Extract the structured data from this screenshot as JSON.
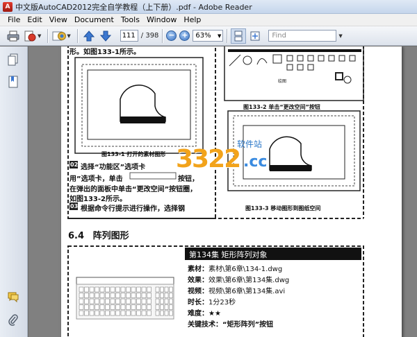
{
  "window": {
    "title": "中文版AutoCAD2012完全自学教程（上下册）.pdf - Adobe Reader"
  },
  "menu": [
    "File",
    "Edit",
    "View",
    "Document",
    "Tools",
    "Window",
    "Help"
  ],
  "toolbar": {
    "page_current": "111",
    "page_total": "/ 398",
    "zoom": "63%",
    "find_placeholder": "Find"
  },
  "doc": {
    "top_line": "形。如图133-1所示。",
    "fig1_caption": "图133-1   打开的素材图形",
    "fig2_caption": "图133-2   单击“更改空间”按钮",
    "fig3_caption": "图133-3   移动图形到图纸空间",
    "step2_num": "02",
    "step2_line1": "选择“功能区”选项卡",
    "step2_line2": "用”选项卡，单击",
    "step2_line2b": "按钮，",
    "step2_line3": "在弹出的面板中单击“更改空间”按钮圈，",
    "step2_line4": "如图133-2所示。",
    "step3_num": "03",
    "step3_text": "根据命令行提示进行操作，选择钢",
    "section_num": "6.4",
    "section_title": "阵列图形",
    "episode_title": "第134集    矩形阵列对象",
    "info": [
      {
        "label": "素材：",
        "value": "素材\\第6章\\134-1.dwg"
      },
      {
        "label": "效果：",
        "value": "效果\\第6章\\第134集.dwg"
      },
      {
        "label": "视频：",
        "value": "视频\\第6章\\第134集.avi"
      },
      {
        "label": "时长：",
        "value": "1分23秒"
      },
      {
        "label": "难度：",
        "value": "★★"
      },
      {
        "label": "关键技术：",
        "value": "“矩形阵列”按钮"
      }
    ],
    "ribbon_label": "绘图",
    "watermark_num": "3322",
    "watermark_cc": ".cc",
    "watermark_site": "软件站"
  }
}
